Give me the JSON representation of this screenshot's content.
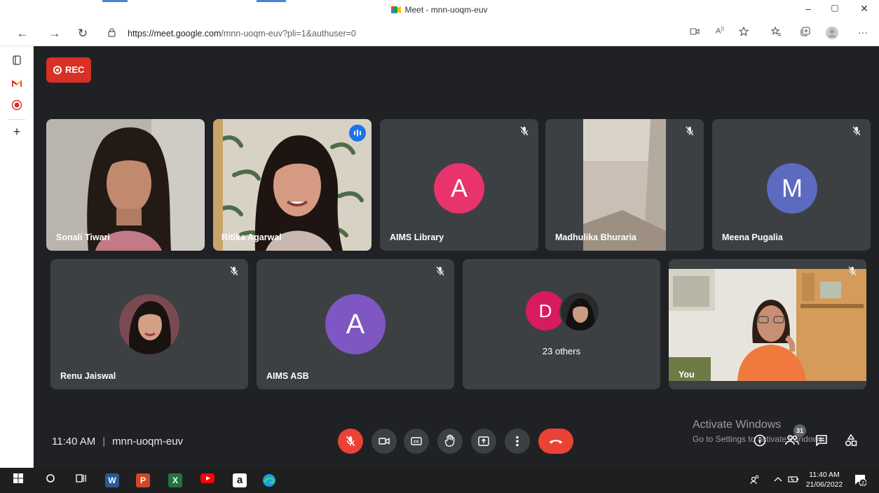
{
  "browser": {
    "window_title": "Meet - mnn-uoqm-euv",
    "url_host": "https://meet.google.com",
    "url_path": "/mnn-uoqm-euv?pli=1&authuser=0",
    "window_controls": {
      "minimize": "–",
      "restore": "▢",
      "close": "✕"
    },
    "nav": {
      "back": "←",
      "forward": "→",
      "reload": "↻"
    },
    "toolbar_icons": [
      "camera-icon",
      "read-aloud-icon",
      "favorite-add-icon",
      "favorites-icon",
      "collections-icon",
      "profile-icon",
      "more-icon"
    ],
    "more": "···"
  },
  "sidebar": {
    "items": [
      "tab-actions-icon",
      "gmail-icon",
      "record-extension-icon",
      "add-icon"
    ]
  },
  "meeting": {
    "rec_label": "REC",
    "time": "11:40 AM",
    "code": "mnn-uoqm-euv",
    "participants_count": "31",
    "tiles_row1": [
      {
        "name": "Sonali Tiwari",
        "type": "video",
        "muted": false
      },
      {
        "name": "Ritika Agarwal",
        "type": "video",
        "speaking": true
      },
      {
        "name": "AIMS Library",
        "type": "letter",
        "letter": "A",
        "color": "#e8336d",
        "muted": true
      },
      {
        "name": "Madhulika Bhuraria",
        "type": "video",
        "muted": true
      },
      {
        "name": "Meena Pugalia",
        "type": "letter",
        "letter": "M",
        "color": "#5c6bc0",
        "muted": true
      }
    ],
    "tiles_row2": [
      {
        "name": "Renu Jaiswal",
        "type": "photo",
        "muted": true
      },
      {
        "name": "AIMS ASB",
        "type": "letter",
        "letter": "A",
        "color": "#7e57c2",
        "muted": true
      },
      {
        "name": "",
        "type": "others",
        "letter": "D",
        "color": "#d81b60",
        "others_label": "23 others"
      },
      {
        "name": "You",
        "type": "video",
        "muted": true
      }
    ]
  },
  "watermark": {
    "line1": "Activate Windows",
    "line2": "Go to Settings to activate Windows."
  },
  "taskbar": {
    "time": "11:40 AM",
    "date": "21/06/2022",
    "notifications": "2"
  },
  "colors": {
    "meet_bg": "#202124",
    "tile_bg": "#3c4043",
    "accent_red": "#ea4335",
    "speaking_outline": "#8ab4f8"
  }
}
